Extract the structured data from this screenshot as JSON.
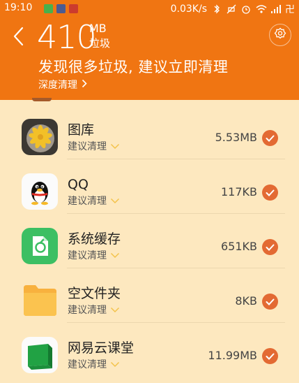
{
  "status_bar": {
    "time": "19:10",
    "network_speed": "0.03K/s",
    "icons_right": [
      "bluetooth-icon",
      "mute-icon",
      "alarm-icon",
      "wifi-icon",
      "signal-icon",
      "extra-icon"
    ],
    "extra_glyph": "卍",
    "notification_colors": [
      "#49b04c",
      "#4b5b92",
      "#cc3b2d"
    ]
  },
  "header": {
    "junk_amount": "410",
    "unit_size": "MB",
    "unit_label": "垃圾",
    "headline": "发现很多垃圾, 建议立即清理",
    "deep_clean_label": "深度清理",
    "bg_color": "#f07512"
  },
  "items": [
    {
      "name": "图库",
      "suggest": "建议清理",
      "size": "5.53MB",
      "icon": "gallery-icon",
      "checked": true
    },
    {
      "name": "QQ",
      "suggest": "建议清理",
      "size": "117KB",
      "icon": "qq-penguin-icon",
      "checked": true
    },
    {
      "name": "系统缓存",
      "suggest": "建议清理",
      "size": "651KB",
      "icon": "system-cache-icon",
      "checked": true
    },
    {
      "name": "空文件夹",
      "suggest": "建议清理",
      "size": "8KB",
      "icon": "folder-icon",
      "checked": true
    },
    {
      "name": "网易云课堂",
      "suggest": "建议清理",
      "size": "11.99MB",
      "icon": "netease-study-icon",
      "checked": true
    }
  ],
  "colors": {
    "list_bg": "#fde8bf",
    "check_bg": "#e36a33",
    "chevron": "#f3c24a"
  }
}
